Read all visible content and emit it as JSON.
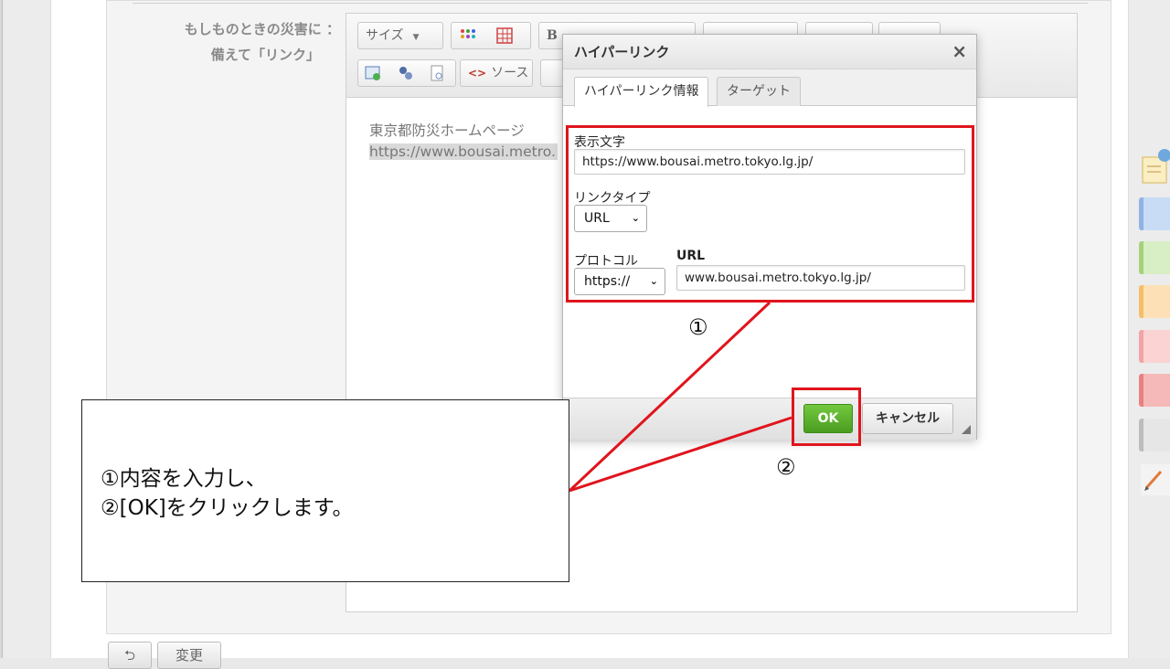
{
  "form": {
    "field_label_line1": "もしものときの災害に ：",
    "field_label_line2": "備えて「リンク」"
  },
  "editor": {
    "toolbar": {
      "size_label": "サイズ",
      "bold_label": "B",
      "source_label": "ソース"
    },
    "content_line1": "東京都防災ホームページ",
    "content_line2": "https://www.bousai.metro."
  },
  "dialog": {
    "title": "ハイパーリンク",
    "close_glyph": "×",
    "tabs": [
      {
        "label": "ハイパーリンク情報",
        "active": true
      },
      {
        "label": "ターゲット",
        "active": false
      }
    ],
    "display_text_label": "表示文字",
    "display_text_value": "https://www.bousai.metro.tokyo.lg.jp/",
    "link_type_label": "リンクタイプ",
    "link_type_value": "URL",
    "protocol_label": "プロトコル",
    "protocol_value": "https://",
    "url_label": "URL",
    "url_value": "www.bousai.metro.tokyo.lg.jp/",
    "ok_label": "OK",
    "cancel_label": "キャンセル"
  },
  "bottom_bar": {
    "back_glyph": "⮌",
    "change_label": "変更"
  },
  "annotations": {
    "marker1": "①",
    "marker2": "②",
    "callout_line1": "①内容を入力し、",
    "callout_line2": "②[OK]をクリックします。",
    "highlight_color": "#e0141d"
  },
  "colors": {
    "ok_green": "#5aae2c",
    "palette": [
      "#c9dcf5",
      "#d8eec4",
      "#fde0b6",
      "#fbd3d3",
      "#f6b9b9",
      "#d0d0d0"
    ]
  }
}
